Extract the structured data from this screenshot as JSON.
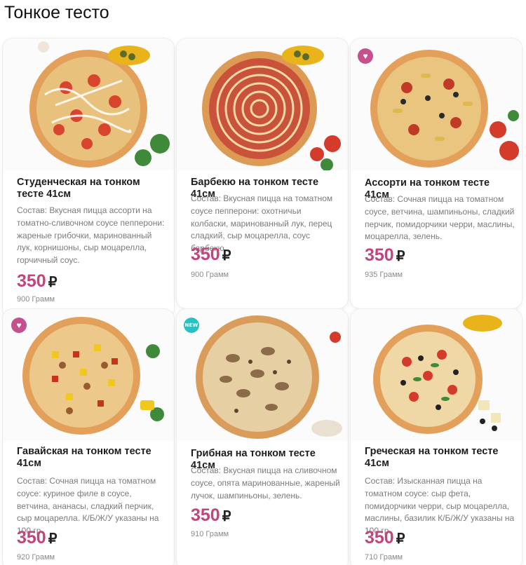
{
  "section": {
    "title": "Тонкое тесто"
  },
  "colors": {
    "price": "#c2457f",
    "badge_fav": "#c5508e",
    "badge_new": "#2bc0c4",
    "description": "#7b7b7b"
  },
  "currency": "₽",
  "products": [
    {
      "name": "Студенческая на тонком тесте 41см",
      "description": "Состав: Вкусная пицца ассорти на томатно-сливочном соусе пепперони: жареные грибочки, маринованный лук, корнишоны, сыр моцарелла, горчичный соус.",
      "price": "350",
      "weight": "900 Грамм",
      "badge": null
    },
    {
      "name": "Барбекю на тонком тесте 41см",
      "description": "Состав: Вкусная пицца на томатном соусе пепперони: охотничьи колбаски, маринованный лук, перец сладкий, сыр моцарелла, соус барбекю.",
      "price": "350",
      "weight": "900 Грамм",
      "badge": null
    },
    {
      "name": "Ассорти на тонком тесте 41см",
      "description": "Состав: Сочная пицца на томатном соусе, ветчина, шампиньоны, сладкий перчик, помидорчики черри, маслины, моцарелла, зелень.",
      "price": "350",
      "weight": "935 Грамм",
      "badge": "heart-icon"
    },
    {
      "name": "Гавайская на тонком тесте 41см",
      "description": "Состав: Сочная пицца на томатном соусе: куриное филе в соусе, ветчина, ананасы, сладкий перчик, сыр моцарелла. К/Б/Ж/У указаны на 100 гр.",
      "price": "350",
      "weight": "920 Грамм",
      "badge": "heart-icon"
    },
    {
      "name": "Грибная на тонком тесте 41см",
      "description": "Состав: Вкусная пицца на сливочном соусе, опята маринованные, жареный лучок, шампиньоны, зелень.",
      "price": "350",
      "weight": "910 Грамм",
      "badge": "NEW"
    },
    {
      "name": "Греческая на тонком тесте 41см",
      "description": "Состав: Изысканная пицца на томатном соусе: сыр фета, помидорчики черри, сыр моцарелла, маслины, базилик К/Б/Ж/У указаны на 100 гр.",
      "price": "350",
      "weight": "710 Грамм",
      "badge": null
    }
  ]
}
